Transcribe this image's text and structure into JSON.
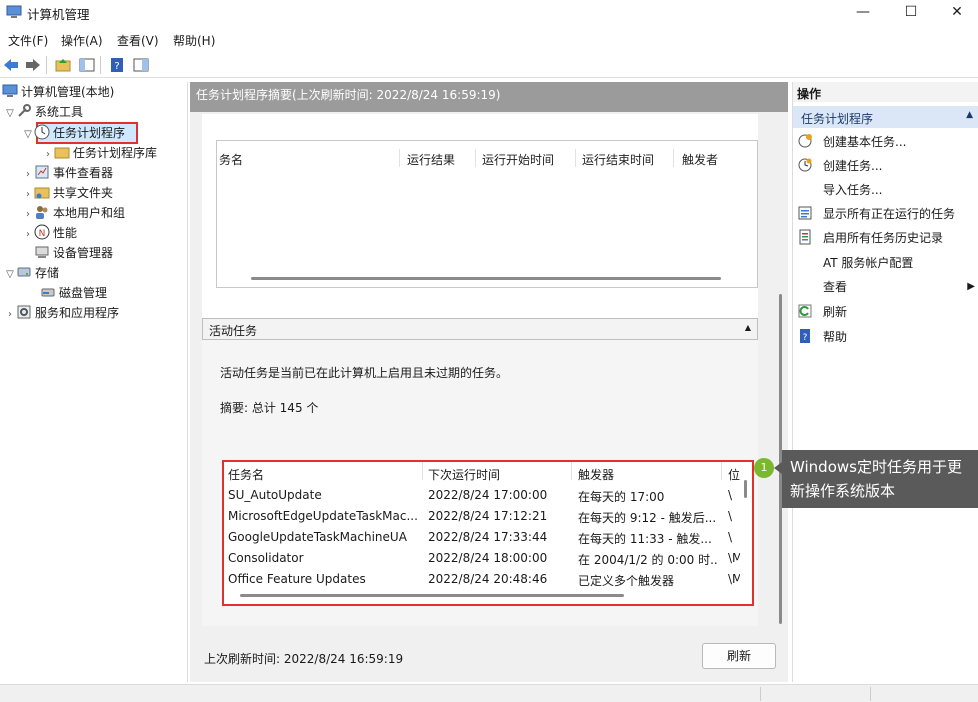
{
  "window": {
    "title": "计算机管理"
  },
  "menu": [
    "文件(F)",
    "操作(A)",
    "查看(V)",
    "帮助(H)"
  ],
  "tree": {
    "root": "计算机管理(本地)",
    "system_tools": "系统工具",
    "task_scheduler": "任务计划程序",
    "task_library": "任务计划程序库",
    "event_viewer": "事件查看器",
    "shared_folders": "共享文件夹",
    "local_users": "本地用户和组",
    "performance": "性能",
    "device_manager": "设备管理器",
    "storage": "存储",
    "disk_management": "磁盘管理",
    "services_apps": "服务和应用程序"
  },
  "center": {
    "header": "任务计划程序摘要(上次刷新时间: 2022/8/24 16:59:19)",
    "summary_columns": [
      "务名",
      "运行结果",
      "运行开始时间",
      "运行结束时间",
      "触发者"
    ],
    "active_section_title": "活动任务",
    "active_desc": "活动任务是当前已在此计算机上启用且未过期的任务。",
    "summary_total": "摘要: 总计 145 个",
    "task_columns": [
      "任务名",
      "下次运行时间",
      "触发器",
      "位"
    ],
    "tasks": [
      {
        "name": "SU_AutoUpdate",
        "next": "2022/8/24 17:00:00",
        "trigger": "在每天的 17:00",
        "loc": "\\"
      },
      {
        "name": "MicrosoftEdgeUpdateTaskMac...",
        "next": "2022/8/24 17:12:21",
        "trigger": "在每天的 9:12 - 触发后...",
        "loc": "\\"
      },
      {
        "name": "GoogleUpdateTaskMachineUA",
        "next": "2022/8/24 17:33:44",
        "trigger": "在每天的 11:33 - 触发...",
        "loc": "\\"
      },
      {
        "name": "Consolidator",
        "next": "2022/8/24 18:00:00",
        "trigger": "在 2004/1/2 的 0:00 时...",
        "loc": "\\M"
      },
      {
        "name": "Office Feature Updates",
        "next": "2022/8/24 20:48:46",
        "trigger": "已定义多个触发器",
        "loc": "\\M"
      }
    ],
    "last_refresh": "上次刷新时间: 2022/8/24 16:59:19",
    "refresh_button": "刷新"
  },
  "actions": {
    "header": "操作",
    "section": "任务计划程序",
    "items": {
      "create_basic": "创建基本任务...",
      "create_task": "创建任务...",
      "import_task": "导入任务...",
      "show_running": "显示所有正在运行的任务",
      "enable_history": "启用所有任务历史记录",
      "at_config": "AT 服务帐户配置",
      "view": "查看",
      "refresh": "刷新",
      "help": "帮助"
    }
  },
  "callout": {
    "badge": "1",
    "text": "Windows定时任务用于更新操作系统版本"
  },
  "colors": {
    "highlight_red": "#e0322d",
    "selection_blue": "#cde8ff",
    "callout_bg": "#5a5a5a",
    "badge_green": "#7cb82f"
  }
}
